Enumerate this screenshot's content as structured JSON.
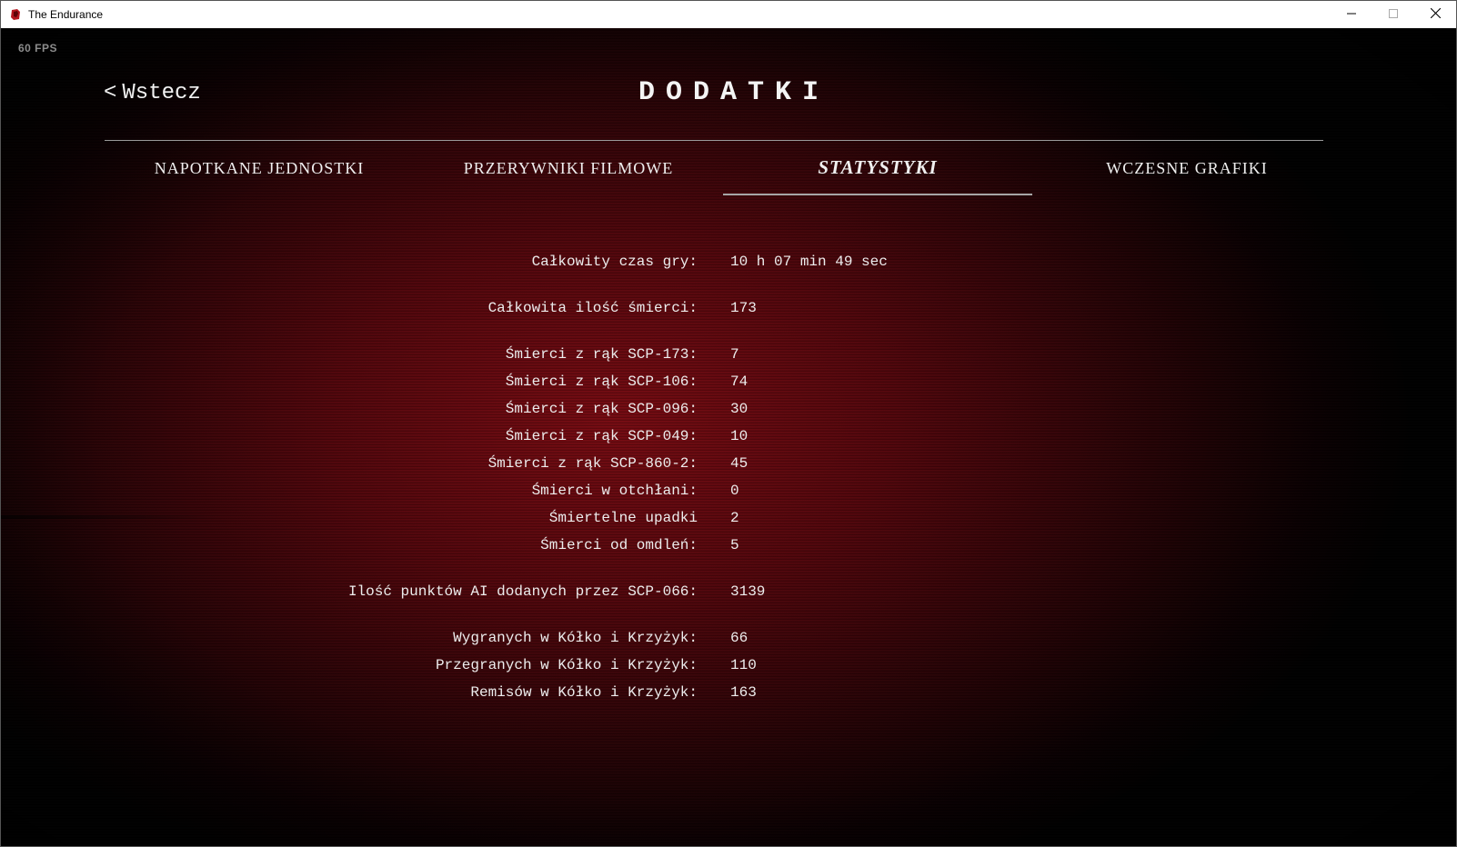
{
  "window": {
    "title": "The Endurance",
    "icon": "game-logo-icon",
    "controls": [
      "minimize-icon",
      "maximize-icon",
      "close-icon"
    ]
  },
  "hud": {
    "fps": "60 FPS"
  },
  "nav": {
    "back_chevron": "<",
    "back_label": "Wstecz"
  },
  "page": {
    "title": "DODATKI"
  },
  "tabs": [
    {
      "label": "NAPOTKANE JEDNOSTKI",
      "active": false
    },
    {
      "label": "PRZERYWNIKI FILMOWE",
      "active": false
    },
    {
      "label": "STATYSTYKI",
      "active": true
    },
    {
      "label": "WCZESNE GRAFIKI",
      "active": false
    }
  ],
  "stats": [
    {
      "label": "Całkowity czas gry:",
      "value": "10 h 07 min 49 sec"
    },
    {
      "label": "Całkowita ilość śmierci:",
      "value": "173"
    },
    {
      "label": "Śmierci z rąk SCP-173:",
      "value": "7"
    },
    {
      "label": "Śmierci z rąk SCP-106:",
      "value": "74"
    },
    {
      "label": "Śmierci z rąk SCP-096:",
      "value": "30"
    },
    {
      "label": "Śmierci z rąk SCP-049:",
      "value": "10"
    },
    {
      "label": "Śmierci z rąk SCP-860-2:",
      "value": "45"
    },
    {
      "label": "Śmierci w otchłani:",
      "value": "0"
    },
    {
      "label": "Śmiertelne upadki",
      "value": "2"
    },
    {
      "label": "Śmierci od omdleń:",
      "value": "5"
    },
    {
      "label": "Ilość punktów AI dodanych przez SCP-066:",
      "value": "3139"
    },
    {
      "label": "Wygranych w Kółko i Krzyżyk:",
      "value": "66"
    },
    {
      "label": "Przegranych w Kółko i Krzyżyk:",
      "value": "110"
    },
    {
      "label": "Remisów w Kółko i Krzyżyk:",
      "value": "163"
    }
  ],
  "colors": {
    "background_red": "#7a0b12",
    "text": "#efefef",
    "fps_text": "#8c8c8c",
    "divider": "#9a9a9a"
  }
}
